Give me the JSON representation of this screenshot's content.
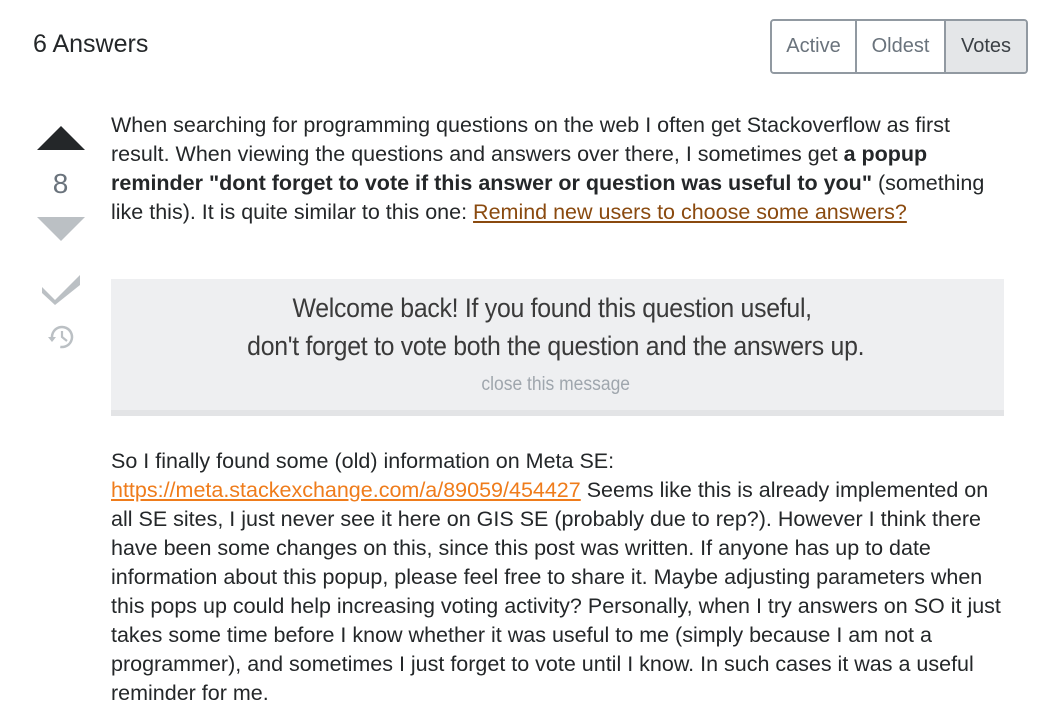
{
  "header": {
    "title": "6 Answers",
    "sort_tabs": [
      {
        "label": "Active",
        "selected": false
      },
      {
        "label": "Oldest",
        "selected": false
      },
      {
        "label": "Votes",
        "selected": true
      }
    ]
  },
  "answer": {
    "vote_count": "8",
    "icons": {
      "upvote": "upvote-arrow-icon",
      "downvote": "downvote-arrow-icon",
      "accept": "checkmark-icon",
      "history": "history-icon"
    },
    "paragraph1": {
      "text_a": "When searching for programming questions on the web I often get Stackoverflow as first result. When viewing the questions and answers over there, I sometimes get ",
      "bold": "a popup reminder \"dont forget to vote if this answer or question was useful to you\"",
      "text_b": " (something like this). It is quite similar to this one: ",
      "link": "Remind new users to choose some answers?"
    },
    "popup": {
      "line1": "Welcome back! If you found this question useful,",
      "line2": "don't forget to vote both the question and the answers up.",
      "close": "close this message"
    },
    "paragraph2": {
      "text_a": "So I finally found some (old) information on Meta SE: ",
      "link": "https://meta.stackexchange.com/a/89059/454427",
      "text_b": " Seems like this is already implemented on all SE sites, I just never see it here on GIS SE (probably due to rep?). However I think there have been some changes on this, since this post was written. If anyone has up to date information about this popup, please feel free to share it. Maybe adjusting parameters when this pops up could help increasing voting activity? Personally, when I try answers on SO it just takes some time before I know whether it was useful to me (simply because I am not a programmer), and sometimes I just forget to vote until I know. In such cases it was a useful reminder for me."
    }
  },
  "colors": {
    "text": "#242729",
    "link_visited": "#8a4a0f",
    "link": "#ef7c1b",
    "muted": "#6a737c",
    "popup_bg": "#eeeff1"
  }
}
